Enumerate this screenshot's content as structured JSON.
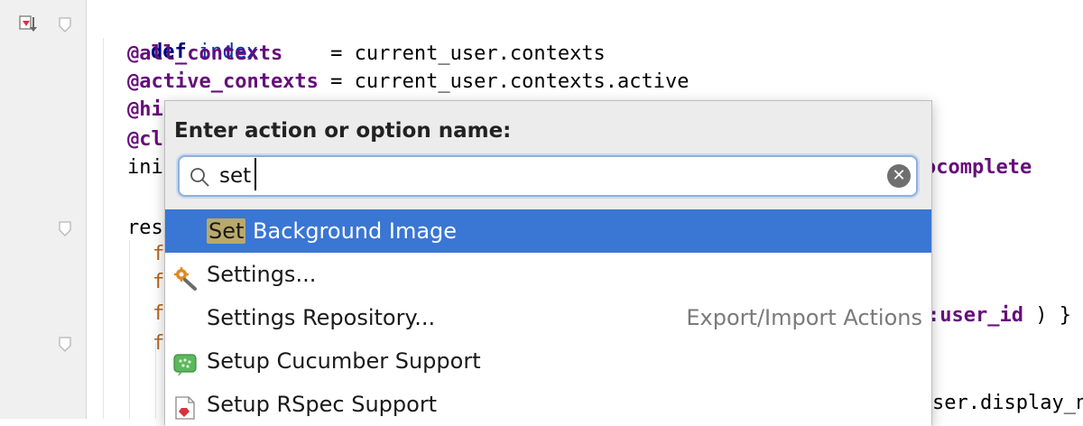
{
  "code": {
    "lines": [
      {
        "keyword": "def",
        "name": "index"
      },
      {
        "ivar": "@all_contexts",
        "rest": "    = current_user.contexts"
      },
      {
        "ivar": "@active_contexts",
        "rest": " = current_user.contexts.active"
      },
      {
        "ivar": "@hi"
      },
      {
        "ivar": "@cl"
      },
      {
        "text": "ini",
        "right_sym": "ocomplete"
      },
      {
        "text": "res"
      },
      {
        "text": "f"
      },
      {
        "text": "f"
      },
      {
        "text": "f",
        "right_sym": ":user_id",
        "right_rest": " ) }"
      },
      {
        "text": "f"
      },
      {
        "right_rest": "ser.display_n"
      }
    ]
  },
  "popup": {
    "title": "Enter action or option name:",
    "search": {
      "value": "set",
      "placeholder": ""
    },
    "clear_glyph": "✕",
    "items": [
      {
        "match": "Set",
        "rest": " Background Image",
        "hint": "",
        "selected": true,
        "icon": "none"
      },
      {
        "match": "",
        "rest": "Settings...",
        "hint": "",
        "selected": false,
        "icon": "settings-wrench-icon"
      },
      {
        "match": "",
        "rest": "Settings Repository...",
        "hint": "Export/Import Actions",
        "selected": false,
        "icon": "none"
      },
      {
        "match": "",
        "rest": "Setup Cucumber Support",
        "hint": "",
        "selected": false,
        "icon": "cucumber-icon"
      },
      {
        "match": "",
        "rest": "Setup RSpec Support",
        "hint": "",
        "selected": false,
        "icon": "rspec-icon"
      }
    ]
  },
  "colors": {
    "selection": "#3a76d4",
    "match_highlight": "#b9a96b",
    "keyword": "#000080",
    "instance_var": "#660e7a"
  }
}
